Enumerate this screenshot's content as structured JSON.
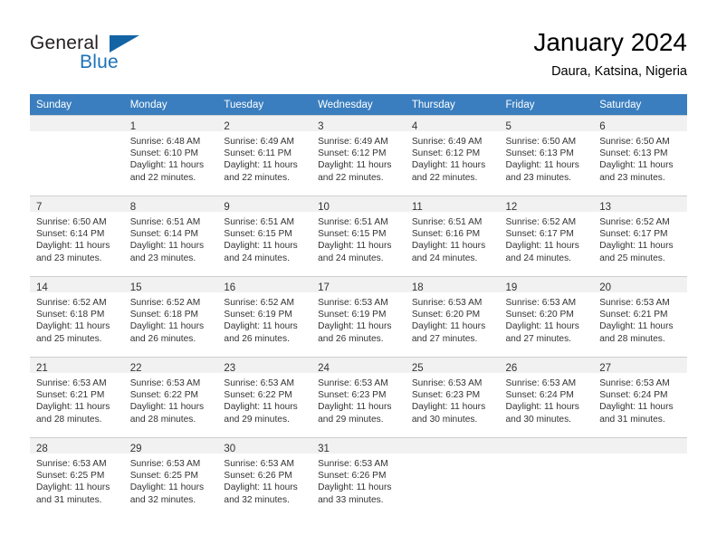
{
  "brand": {
    "word_one": "General",
    "word_two": "Blue",
    "logo_icon": "triangle-logo-icon",
    "colors": {
      "dark": "#231f20",
      "blue": "#1c72b8",
      "triangle": "#1364a5"
    }
  },
  "header": {
    "title": "January 2024",
    "location": "Daura, Katsina, Nigeria"
  },
  "calendar": {
    "header_bg": "#3a7ebf",
    "daynum_bg": "#f1f1f1",
    "weekdays": [
      "Sunday",
      "Monday",
      "Tuesday",
      "Wednesday",
      "Thursday",
      "Friday",
      "Saturday"
    ],
    "weeks": [
      [
        {
          "day": "",
          "lines": []
        },
        {
          "day": "1",
          "lines": [
            "Sunrise: 6:48 AM",
            "Sunset: 6:10 PM",
            "Daylight: 11 hours",
            "and 22 minutes."
          ]
        },
        {
          "day": "2",
          "lines": [
            "Sunrise: 6:49 AM",
            "Sunset: 6:11 PM",
            "Daylight: 11 hours",
            "and 22 minutes."
          ]
        },
        {
          "day": "3",
          "lines": [
            "Sunrise: 6:49 AM",
            "Sunset: 6:12 PM",
            "Daylight: 11 hours",
            "and 22 minutes."
          ]
        },
        {
          "day": "4",
          "lines": [
            "Sunrise: 6:49 AM",
            "Sunset: 6:12 PM",
            "Daylight: 11 hours",
            "and 22 minutes."
          ]
        },
        {
          "day": "5",
          "lines": [
            "Sunrise: 6:50 AM",
            "Sunset: 6:13 PM",
            "Daylight: 11 hours",
            "and 23 minutes."
          ]
        },
        {
          "day": "6",
          "lines": [
            "Sunrise: 6:50 AM",
            "Sunset: 6:13 PM",
            "Daylight: 11 hours",
            "and 23 minutes."
          ]
        }
      ],
      [
        {
          "day": "7",
          "lines": [
            "Sunrise: 6:50 AM",
            "Sunset: 6:14 PM",
            "Daylight: 11 hours",
            "and 23 minutes."
          ]
        },
        {
          "day": "8",
          "lines": [
            "Sunrise: 6:51 AM",
            "Sunset: 6:14 PM",
            "Daylight: 11 hours",
            "and 23 minutes."
          ]
        },
        {
          "day": "9",
          "lines": [
            "Sunrise: 6:51 AM",
            "Sunset: 6:15 PM",
            "Daylight: 11 hours",
            "and 24 minutes."
          ]
        },
        {
          "day": "10",
          "lines": [
            "Sunrise: 6:51 AM",
            "Sunset: 6:15 PM",
            "Daylight: 11 hours",
            "and 24 minutes."
          ]
        },
        {
          "day": "11",
          "lines": [
            "Sunrise: 6:51 AM",
            "Sunset: 6:16 PM",
            "Daylight: 11 hours",
            "and 24 minutes."
          ]
        },
        {
          "day": "12",
          "lines": [
            "Sunrise: 6:52 AM",
            "Sunset: 6:17 PM",
            "Daylight: 11 hours",
            "and 24 minutes."
          ]
        },
        {
          "day": "13",
          "lines": [
            "Sunrise: 6:52 AM",
            "Sunset: 6:17 PM",
            "Daylight: 11 hours",
            "and 25 minutes."
          ]
        }
      ],
      [
        {
          "day": "14",
          "lines": [
            "Sunrise: 6:52 AM",
            "Sunset: 6:18 PM",
            "Daylight: 11 hours",
            "and 25 minutes."
          ]
        },
        {
          "day": "15",
          "lines": [
            "Sunrise: 6:52 AM",
            "Sunset: 6:18 PM",
            "Daylight: 11 hours",
            "and 26 minutes."
          ]
        },
        {
          "day": "16",
          "lines": [
            "Sunrise: 6:52 AM",
            "Sunset: 6:19 PM",
            "Daylight: 11 hours",
            "and 26 minutes."
          ]
        },
        {
          "day": "17",
          "lines": [
            "Sunrise: 6:53 AM",
            "Sunset: 6:19 PM",
            "Daylight: 11 hours",
            "and 26 minutes."
          ]
        },
        {
          "day": "18",
          "lines": [
            "Sunrise: 6:53 AM",
            "Sunset: 6:20 PM",
            "Daylight: 11 hours",
            "and 27 minutes."
          ]
        },
        {
          "day": "19",
          "lines": [
            "Sunrise: 6:53 AM",
            "Sunset: 6:20 PM",
            "Daylight: 11 hours",
            "and 27 minutes."
          ]
        },
        {
          "day": "20",
          "lines": [
            "Sunrise: 6:53 AM",
            "Sunset: 6:21 PM",
            "Daylight: 11 hours",
            "and 28 minutes."
          ]
        }
      ],
      [
        {
          "day": "21",
          "lines": [
            "Sunrise: 6:53 AM",
            "Sunset: 6:21 PM",
            "Daylight: 11 hours",
            "and 28 minutes."
          ]
        },
        {
          "day": "22",
          "lines": [
            "Sunrise: 6:53 AM",
            "Sunset: 6:22 PM",
            "Daylight: 11 hours",
            "and 28 minutes."
          ]
        },
        {
          "day": "23",
          "lines": [
            "Sunrise: 6:53 AM",
            "Sunset: 6:22 PM",
            "Daylight: 11 hours",
            "and 29 minutes."
          ]
        },
        {
          "day": "24",
          "lines": [
            "Sunrise: 6:53 AM",
            "Sunset: 6:23 PM",
            "Daylight: 11 hours",
            "and 29 minutes."
          ]
        },
        {
          "day": "25",
          "lines": [
            "Sunrise: 6:53 AM",
            "Sunset: 6:23 PM",
            "Daylight: 11 hours",
            "and 30 minutes."
          ]
        },
        {
          "day": "26",
          "lines": [
            "Sunrise: 6:53 AM",
            "Sunset: 6:24 PM",
            "Daylight: 11 hours",
            "and 30 minutes."
          ]
        },
        {
          "day": "27",
          "lines": [
            "Sunrise: 6:53 AM",
            "Sunset: 6:24 PM",
            "Daylight: 11 hours",
            "and 31 minutes."
          ]
        }
      ],
      [
        {
          "day": "28",
          "lines": [
            "Sunrise: 6:53 AM",
            "Sunset: 6:25 PM",
            "Daylight: 11 hours",
            "and 31 minutes."
          ]
        },
        {
          "day": "29",
          "lines": [
            "Sunrise: 6:53 AM",
            "Sunset: 6:25 PM",
            "Daylight: 11 hours",
            "and 32 minutes."
          ]
        },
        {
          "day": "30",
          "lines": [
            "Sunrise: 6:53 AM",
            "Sunset: 6:26 PM",
            "Daylight: 11 hours",
            "and 32 minutes."
          ]
        },
        {
          "day": "31",
          "lines": [
            "Sunrise: 6:53 AM",
            "Sunset: 6:26 PM",
            "Daylight: 11 hours",
            "and 33 minutes."
          ]
        },
        {
          "day": "",
          "lines": []
        },
        {
          "day": "",
          "lines": []
        },
        {
          "day": "",
          "lines": []
        }
      ]
    ]
  }
}
